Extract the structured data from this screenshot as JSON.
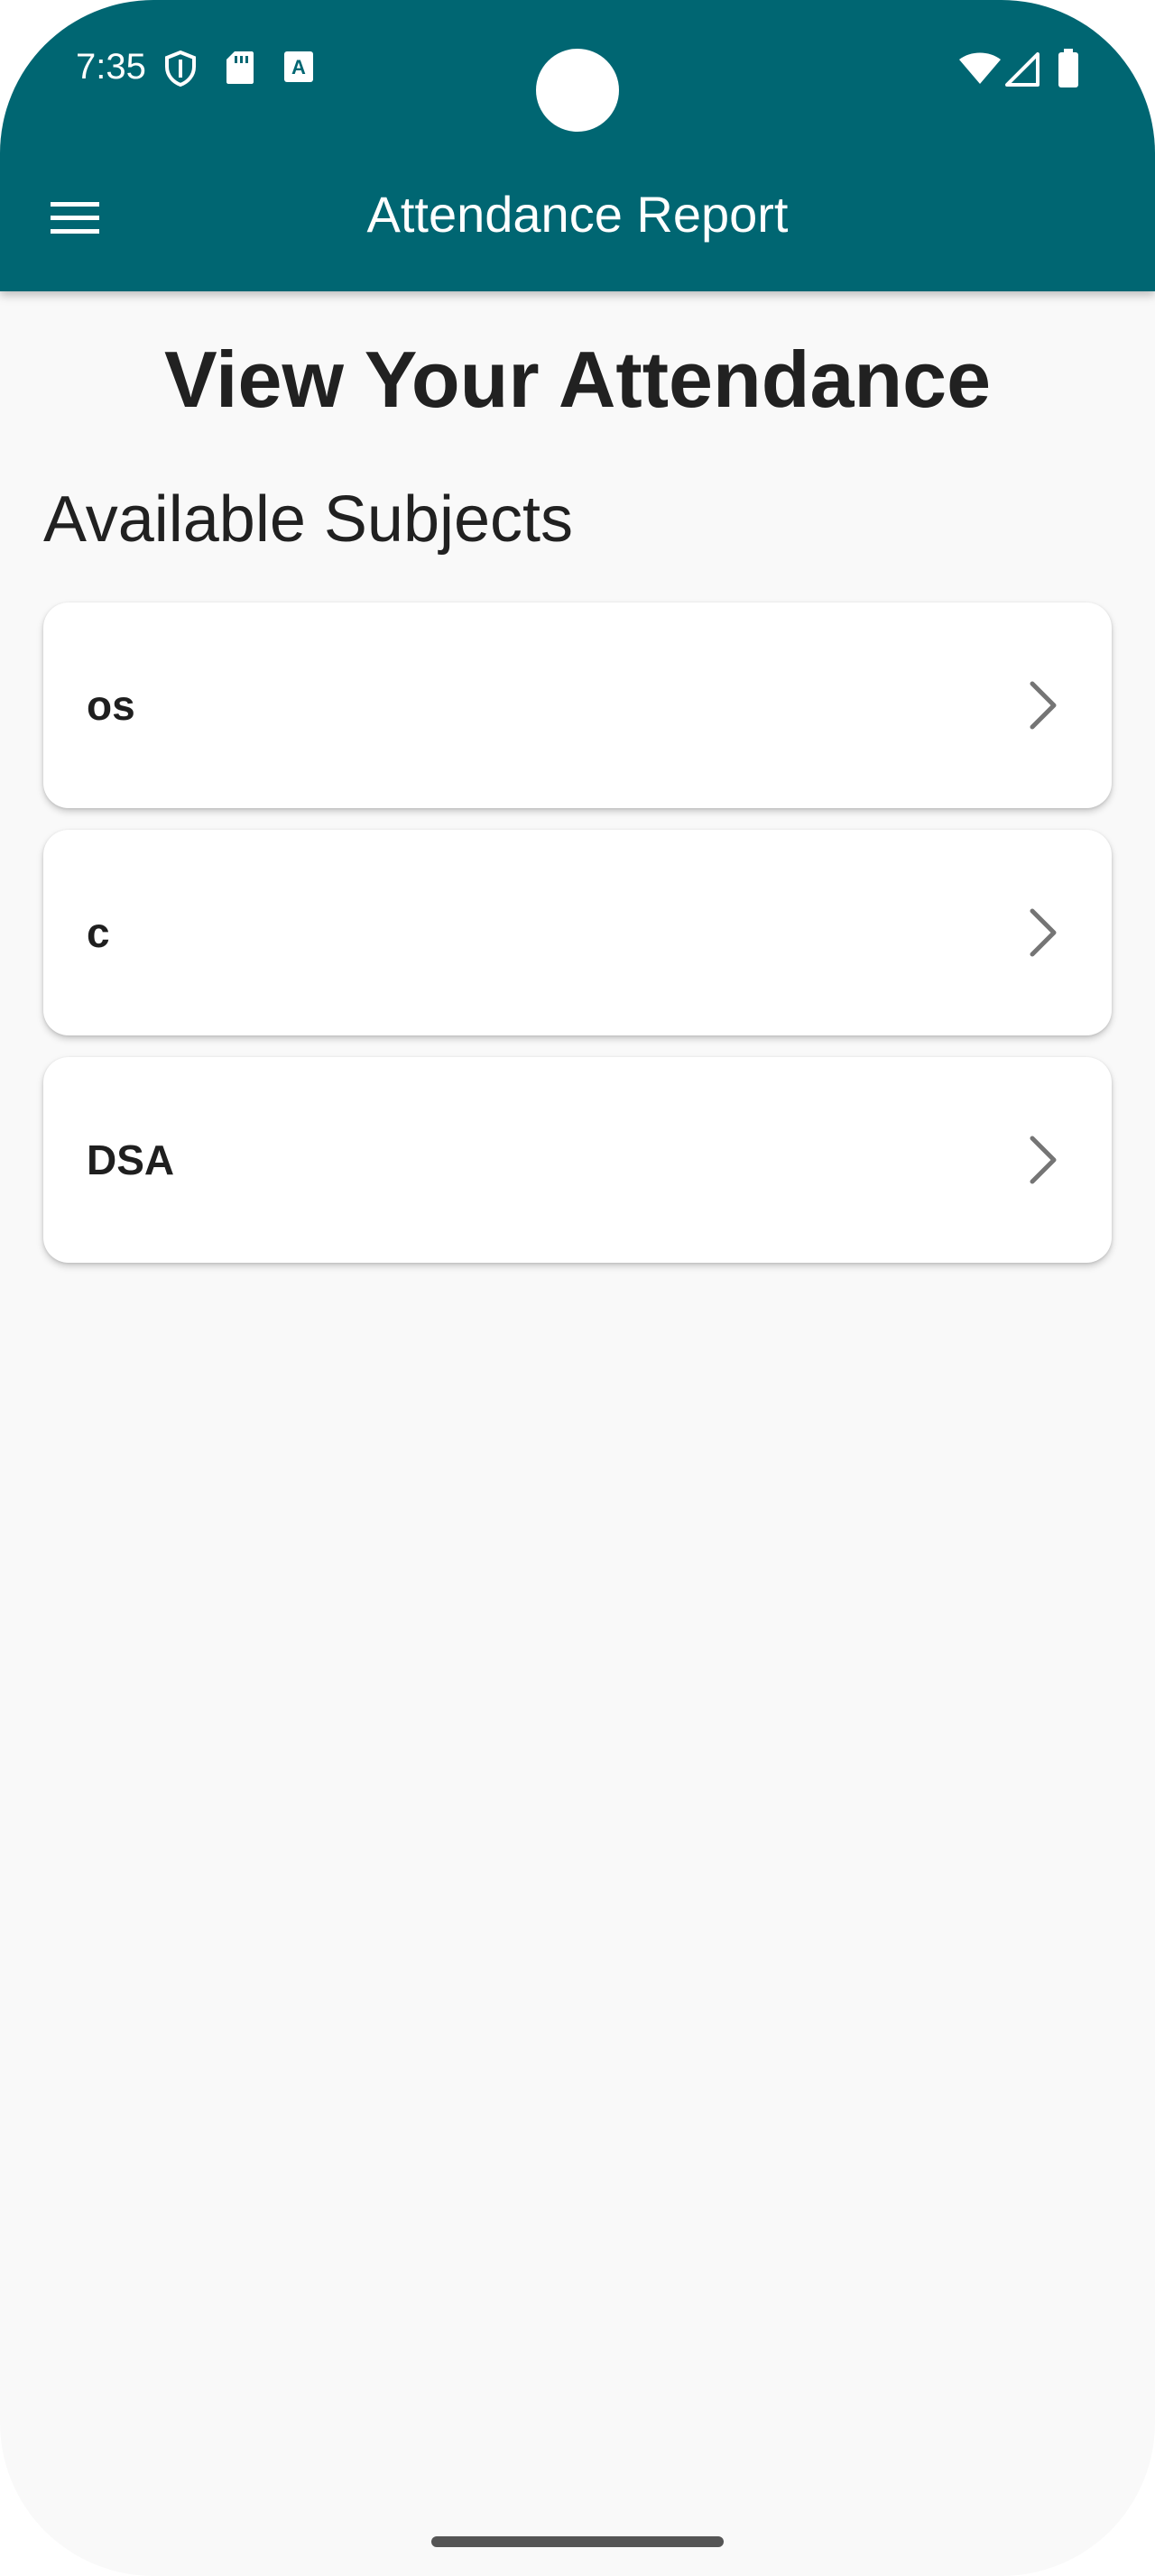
{
  "status_bar": {
    "time": "7:35",
    "left_icons": [
      "shield-icon",
      "sd-card-icon",
      "text-a-icon"
    ],
    "right_icons": [
      "wifi-icon",
      "cell-signal-icon",
      "battery-icon"
    ]
  },
  "app_bar": {
    "title": "Attendance Report",
    "menu_icon": "menu-icon",
    "color": "#006672"
  },
  "main": {
    "page_title": "View Your Attendance",
    "section_title": "Available Subjects",
    "subjects": [
      {
        "label": "os",
        "icon": "chevron-right-icon"
      },
      {
        "label": "c",
        "icon": "chevron-right-icon"
      },
      {
        "label": "DSA",
        "icon": "chevron-right-icon"
      }
    ]
  },
  "colors": {
    "primary": "#006672",
    "background": "#f9f9f9",
    "card": "#ffffff",
    "text": "#212121"
  }
}
